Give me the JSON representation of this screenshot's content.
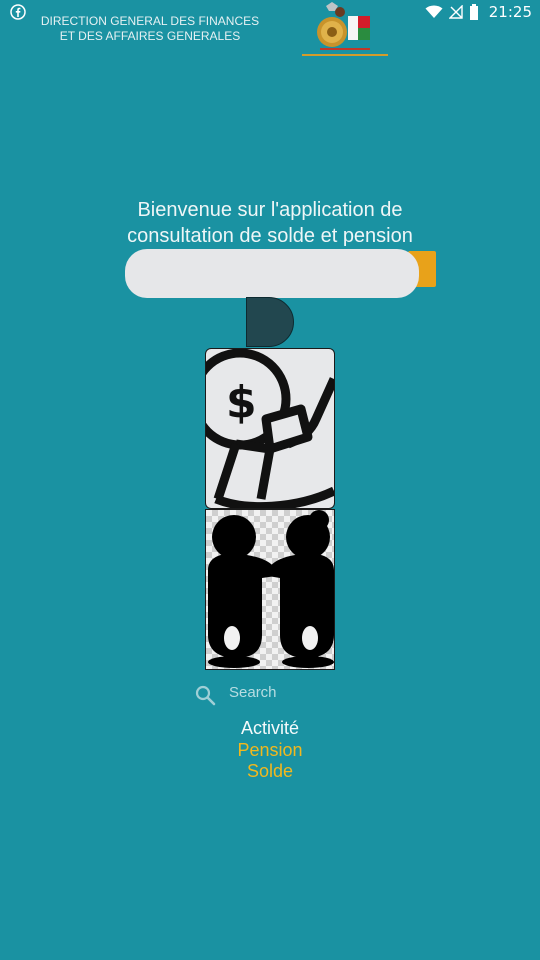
{
  "status_bar": {
    "time": "21:25",
    "left_icon": "facebook-notification-icon",
    "icons": [
      "wifi-icon",
      "no-signal-icon",
      "battery-icon"
    ]
  },
  "header": {
    "org_line1": "DIRECTION GENERAL DES FINANCES",
    "org_line2": "ET DES AFFAIRES GENERALES",
    "logo_icon": "ministry-logo-with-flag"
  },
  "main": {
    "welcome_line1": "Bienvenue sur l'application de",
    "welcome_line2": "consultation de solde et pension",
    "input_value": "",
    "d_button_icon": "half-circle-button",
    "images": [
      "pension-money-hand-icon",
      "elderly-couple-icon"
    ]
  },
  "search": {
    "placeholder": "Search",
    "icon": "search-icon"
  },
  "menu": {
    "items": [
      {
        "label": "Activité",
        "active": true
      },
      {
        "label": "Pension",
        "active": false
      },
      {
        "label": "Solde",
        "active": false
      }
    ]
  },
  "colors": {
    "background": "#1a92a2",
    "accent": "#f2b81e",
    "dark_button": "#22474f",
    "field": "#e6e7e9"
  }
}
